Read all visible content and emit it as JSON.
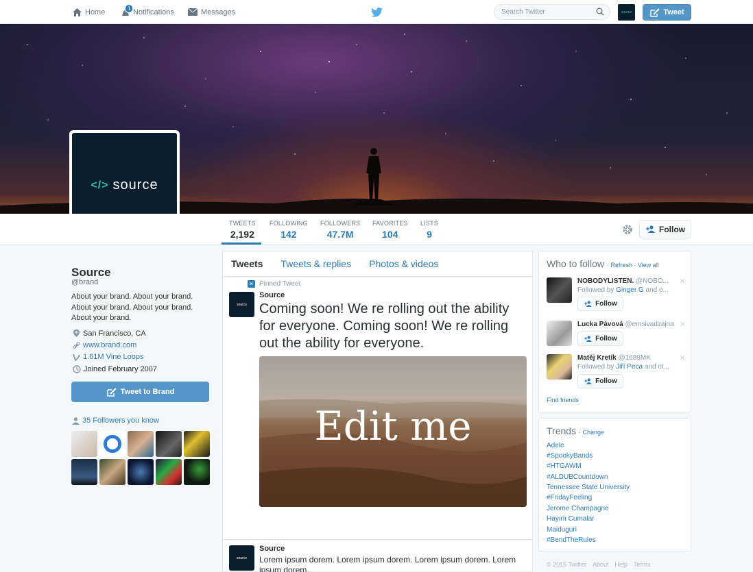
{
  "nav": {
    "home": "Home",
    "notifications": "Notifications",
    "notif_count": "1",
    "messages": "Messages",
    "search_placeholder": "Search Twitter",
    "tweet": "Tweet"
  },
  "profile": {
    "logo_text": "source",
    "name": "Source",
    "handle": "@brand",
    "bio": "About your brand. About your brand. About your brand. About your brand. About your brand.",
    "location": "San Francisco, CA",
    "website": "www.brand.com",
    "vine": "1.61M Vine Loops",
    "joined": "Joined February 2007",
    "tweet_to": "Tweet to Brand",
    "followers_you_know": "35 Followers you know"
  },
  "stats": [
    {
      "label": "TWEETS",
      "value": "2,192"
    },
    {
      "label": "FOLLOWING",
      "value": "142"
    },
    {
      "label": "FOLLOWERS",
      "value": "47.7M"
    },
    {
      "label": "FAVORITES",
      "value": "104"
    },
    {
      "label": "LISTS",
      "value": "9"
    }
  ],
  "follow_label": "Follow",
  "timeline": {
    "tabs": [
      "Tweets",
      "Tweets & replies",
      "Photos & videos"
    ],
    "pinned_label": "Pinned Tweet",
    "tweet1": {
      "author": "Source",
      "text": "Coming soon! We re rolling  out the ability for everyone. Coming soon! We re rolling out the ability for everyone.",
      "media_text": "Edit me"
    },
    "tweet2": {
      "author": "Source",
      "text": "Lorem ipsum dorem. Lorem ipsum dorem. Lorem ipsum dorem. Lorem ipsum dorem."
    }
  },
  "who_to_follow": {
    "title": "Who to follow",
    "refresh": "Refresh",
    "view_all": "View all",
    "users": [
      {
        "name": "NOBODYLISTEN.",
        "handle": "@NOBO...",
        "followed_by_prefix": "Followed by ",
        "followed_by": "Ginger G",
        "followed_by_suffix": " and o..."
      },
      {
        "name": "Lucka Pávová",
        "handle": "@emsivadzajna",
        "followed_by_prefix": "",
        "followed_by": "",
        "followed_by_suffix": ""
      },
      {
        "name": "Matěj Kretík",
        "handle": "@1688MK",
        "followed_by_prefix": "Followed by ",
        "followed_by": "Jiří Peca",
        "followed_by_suffix": " and ot..."
      }
    ],
    "find_friends": "Find friends"
  },
  "trends": {
    "title": "Trends",
    "change": "Change",
    "items": [
      "Adele",
      "#SpookyBands",
      "#HTGAWM",
      "#ALDUBCountdown",
      "Tennessee State University",
      "#FridayFeeling",
      "Jerome Champagne",
      "Hayırlı Cumalar",
      "Maiduguri",
      "#BendTheRules"
    ]
  },
  "footer": [
    "© 2015 Twitter",
    "About",
    "Help",
    "Terms"
  ],
  "colors": {
    "accent": "#2b7bb9",
    "button": "#5596c8",
    "brand_dark": "#0b1e2d",
    "brand_green": "#32c5a0"
  }
}
